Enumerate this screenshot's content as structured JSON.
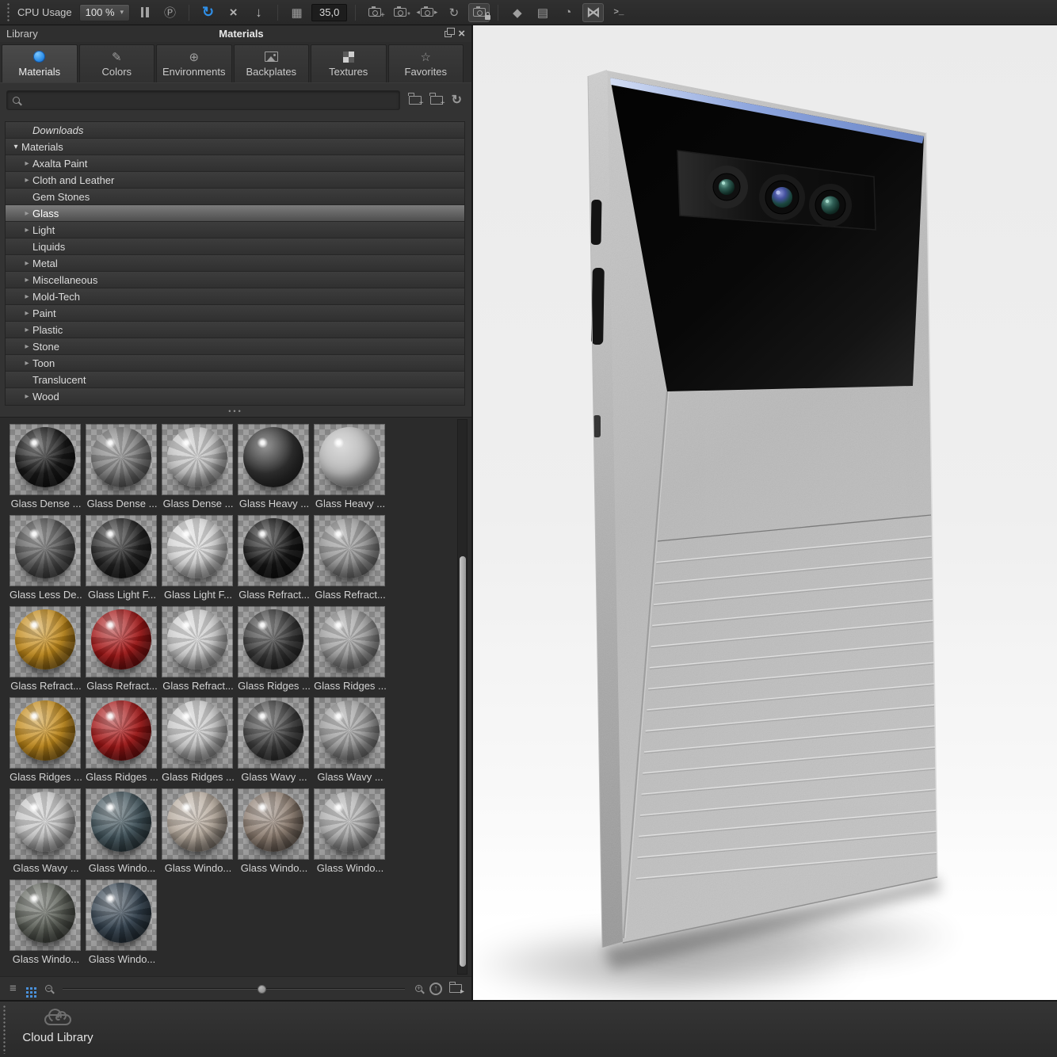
{
  "toolbar": {
    "cpu_label": "CPU Usage",
    "cpu_value": "100 %",
    "frame_value": "35,0"
  },
  "glyphs": {
    "caret": "▾",
    "p_circle": "Ⓟ",
    "refresh": "↻",
    "expand": "×",
    "download": "↓",
    "grid": "▦",
    "cube": "◆",
    "layout": "▤",
    "gauge": "◔",
    "nodes": "⋈",
    "terminal": ">_",
    "arrow_left": "◂",
    "arrow_right": "▸",
    "plus": "+",
    "asterisk": "*",
    "minus": "−",
    "up_arrow": "↑",
    "list": "≡",
    "star": "☆",
    "pencil": "✎",
    "globe": "⊕",
    "close": "×",
    "dots": "•••",
    "tree_collapsed": "▸",
    "tree_expanded": "▾"
  },
  "library": {
    "window_label": "Library",
    "title": "Materials",
    "tabs": [
      {
        "label": "Materials",
        "icon": "material-ball",
        "active": true
      },
      {
        "label": "Colors",
        "icon": "pencil",
        "active": false
      },
      {
        "label": "Environments",
        "icon": "globe",
        "active": false
      },
      {
        "label": "Backplates",
        "icon": "image",
        "active": false
      },
      {
        "label": "Textures",
        "icon": "checker",
        "active": false
      },
      {
        "label": "Favorites",
        "icon": "star",
        "active": false
      }
    ],
    "search": {
      "value": "",
      "placeholder": ""
    },
    "tree": [
      {
        "label": "Downloads",
        "arrow": "none",
        "indent": 1,
        "italic": true
      },
      {
        "label": "Materials",
        "arrow": "expanded",
        "indent": 0
      },
      {
        "label": "Axalta Paint",
        "arrow": "collapsed",
        "indent": 1
      },
      {
        "label": "Cloth and Leather",
        "arrow": "collapsed",
        "indent": 1
      },
      {
        "label": "Gem Stones",
        "arrow": "none",
        "indent": 1
      },
      {
        "label": "Glass",
        "arrow": "collapsed",
        "indent": 1,
        "selected": true
      },
      {
        "label": "Light",
        "arrow": "collapsed",
        "indent": 1
      },
      {
        "label": "Liquids",
        "arrow": "none",
        "indent": 1
      },
      {
        "label": "Metal",
        "arrow": "collapsed",
        "indent": 1
      },
      {
        "label": "Miscellaneous",
        "arrow": "collapsed",
        "indent": 1
      },
      {
        "label": "Mold-Tech",
        "arrow": "collapsed",
        "indent": 1
      },
      {
        "label": "Paint",
        "arrow": "collapsed",
        "indent": 1
      },
      {
        "label": "Plastic",
        "arrow": "collapsed",
        "indent": 1
      },
      {
        "label": "Stone",
        "arrow": "collapsed",
        "indent": 1
      },
      {
        "label": "Toon",
        "arrow": "collapsed",
        "indent": 1
      },
      {
        "label": "Translucent",
        "arrow": "none",
        "indent": 1
      },
      {
        "label": "Wood",
        "arrow": "collapsed",
        "indent": 1
      }
    ],
    "materials": [
      {
        "label": "Glass Dense ...",
        "color": "#1a1a1a",
        "finish": "glossy"
      },
      {
        "label": "Glass Dense ...",
        "color": "#7d7d7d",
        "finish": "glossy"
      },
      {
        "label": "Glass Dense ...",
        "color": "#c0c0c0",
        "finish": "glossy"
      },
      {
        "label": "Glass Heavy ...",
        "color": "#303030",
        "finish": "matte"
      },
      {
        "label": "Glass Heavy ...",
        "color": "#b8b8b8",
        "finish": "matte"
      },
      {
        "label": "Glass Less De...",
        "color": "#565656",
        "finish": "glossy"
      },
      {
        "label": "Glass Light F...",
        "color": "#242424",
        "finish": "glossy"
      },
      {
        "label": "Glass Light F...",
        "color": "#d4d4d4",
        "finish": "glossy"
      },
      {
        "label": "Glass Refract...",
        "color": "#161616",
        "finish": "glossy"
      },
      {
        "label": "Glass Refract...",
        "color": "#939393",
        "finish": "glossy"
      },
      {
        "label": "Glass Refract...",
        "color": "#c28a1a",
        "finish": "glossy"
      },
      {
        "label": "Glass Refract...",
        "color": "#a51616",
        "finish": "glossy"
      },
      {
        "label": "Glass Refract...",
        "color": "#cdcdcd",
        "finish": "glossy"
      },
      {
        "label": "Glass Ridges ...",
        "color": "#3a3a3a",
        "finish": "glossy"
      },
      {
        "label": "Glass Ridges ...",
        "color": "#9e9e9e",
        "finish": "glossy"
      },
      {
        "label": "Glass Ridges ...",
        "color": "#c28a1a",
        "finish": "glossy"
      },
      {
        "label": "Glass Ridges ...",
        "color": "#a51616",
        "finish": "glossy"
      },
      {
        "label": "Glass Ridges ...",
        "color": "#c8c8c8",
        "finish": "glossy"
      },
      {
        "label": "Glass Wavy ...",
        "color": "#424242",
        "finish": "glossy"
      },
      {
        "label": "Glass Wavy ...",
        "color": "#9c9c9c",
        "finish": "glossy"
      },
      {
        "label": "Glass Wavy ...",
        "color": "#c6c6c6",
        "finish": "glossy"
      },
      {
        "label": "Glass Windo...",
        "color": "#42555d",
        "finish": "glossy"
      },
      {
        "label": "Glass Windo...",
        "color": "#b7ab9e",
        "finish": "glossy"
      },
      {
        "label": "Glass Windo...",
        "color": "#8f7f72",
        "finish": "glossy"
      },
      {
        "label": "Glass Windo...",
        "color": "#acacac",
        "finish": "glossy"
      },
      {
        "label": "Glass Windo...",
        "color": "#5d6159",
        "finish": "glossy"
      },
      {
        "label": "Glass Windo...",
        "color": "#344350",
        "finish": "glossy"
      }
    ],
    "footer": {
      "zoom_percent": 58
    }
  },
  "cloud_bar": {
    "label": "Cloud Library"
  },
  "viewport": {
    "grille_line_count": 17,
    "background": "#efefef",
    "body_color": "#bcbcbc",
    "glass_color": "#0a0a0a",
    "glass_edge_blue": "#8ea6de"
  },
  "colors": {
    "accent_blue": "#2f8fe8",
    "grid_icon_blue": "#4a90d9",
    "selection_gray": "#6e6e6e",
    "amber_material": "#c28a1a",
    "red_material": "#a51616"
  }
}
